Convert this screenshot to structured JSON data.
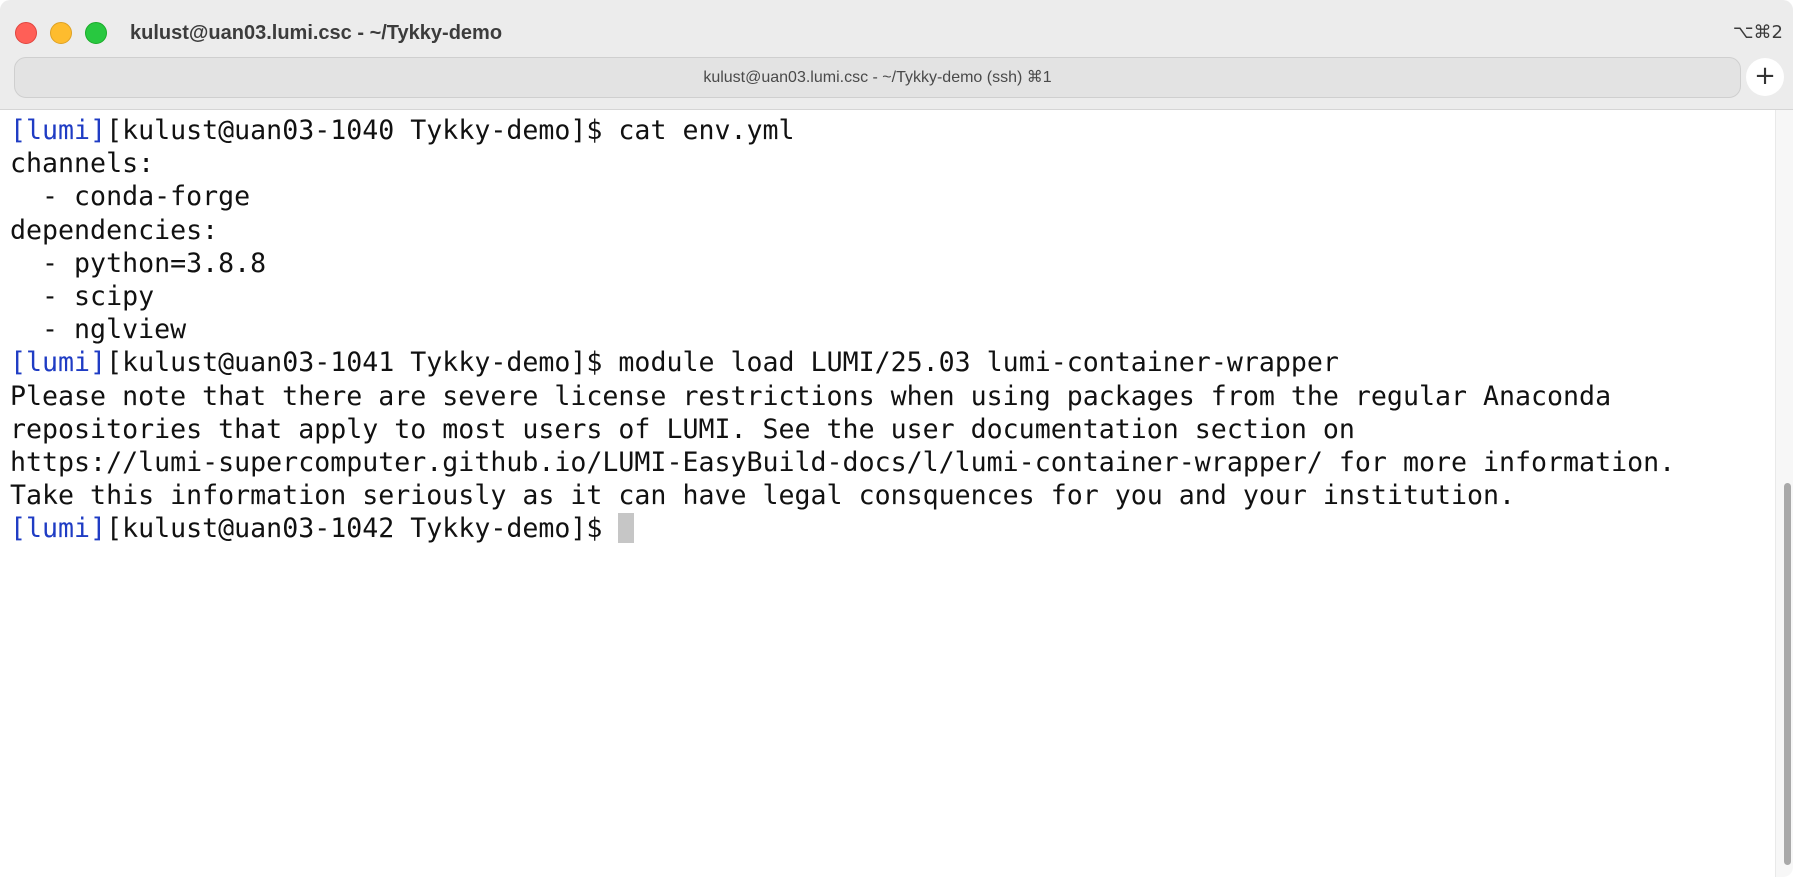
{
  "window": {
    "title": "kulust@uan03.lumi.csc - ~/Tykky-demo",
    "shortcut": "⌥⌘2"
  },
  "tab": {
    "label": "kulust@uan03.lumi.csc - ~/Tykky-demo (ssh) ⌘1",
    "new_tab_label": "+"
  },
  "terminal": {
    "lines": [
      {
        "prefix": "[lumi]",
        "text": "[kulust@uan03-1040 Tykky-demo]$ cat env.yml"
      },
      {
        "prefix": "",
        "text": "channels:"
      },
      {
        "prefix": "",
        "text": "  - conda-forge"
      },
      {
        "prefix": "",
        "text": "dependencies:"
      },
      {
        "prefix": "",
        "text": "  - python=3.8.8"
      },
      {
        "prefix": "",
        "text": "  - scipy"
      },
      {
        "prefix": "",
        "text": "  - nglview"
      },
      {
        "prefix": "[lumi]",
        "text": "[kulust@uan03-1041 Tykky-demo]$ module load LUMI/25.03 lumi-container-wrapper"
      },
      {
        "prefix": "",
        "text": "Please note that there are severe license restrictions when using packages from the regular Anaconda"
      },
      {
        "prefix": "",
        "text": "repositories that apply to most users of LUMI. See the user documentation section on"
      },
      {
        "prefix": "",
        "text": "https://lumi-supercomputer.github.io/LUMI-EasyBuild-docs/l/lumi-container-wrapper/ for more information."
      },
      {
        "prefix": "",
        "text": "Take this information seriously as it can have legal consquences for you and your institution."
      },
      {
        "prefix": "[lumi]",
        "text": "[kulust@uan03-1042 Tykky-demo]$ "
      }
    ]
  },
  "colors": {
    "prompt_prefix": "#1f3cc4",
    "text": "#111111",
    "background": "#ffffff",
    "cursor": "#c6c6c6"
  }
}
